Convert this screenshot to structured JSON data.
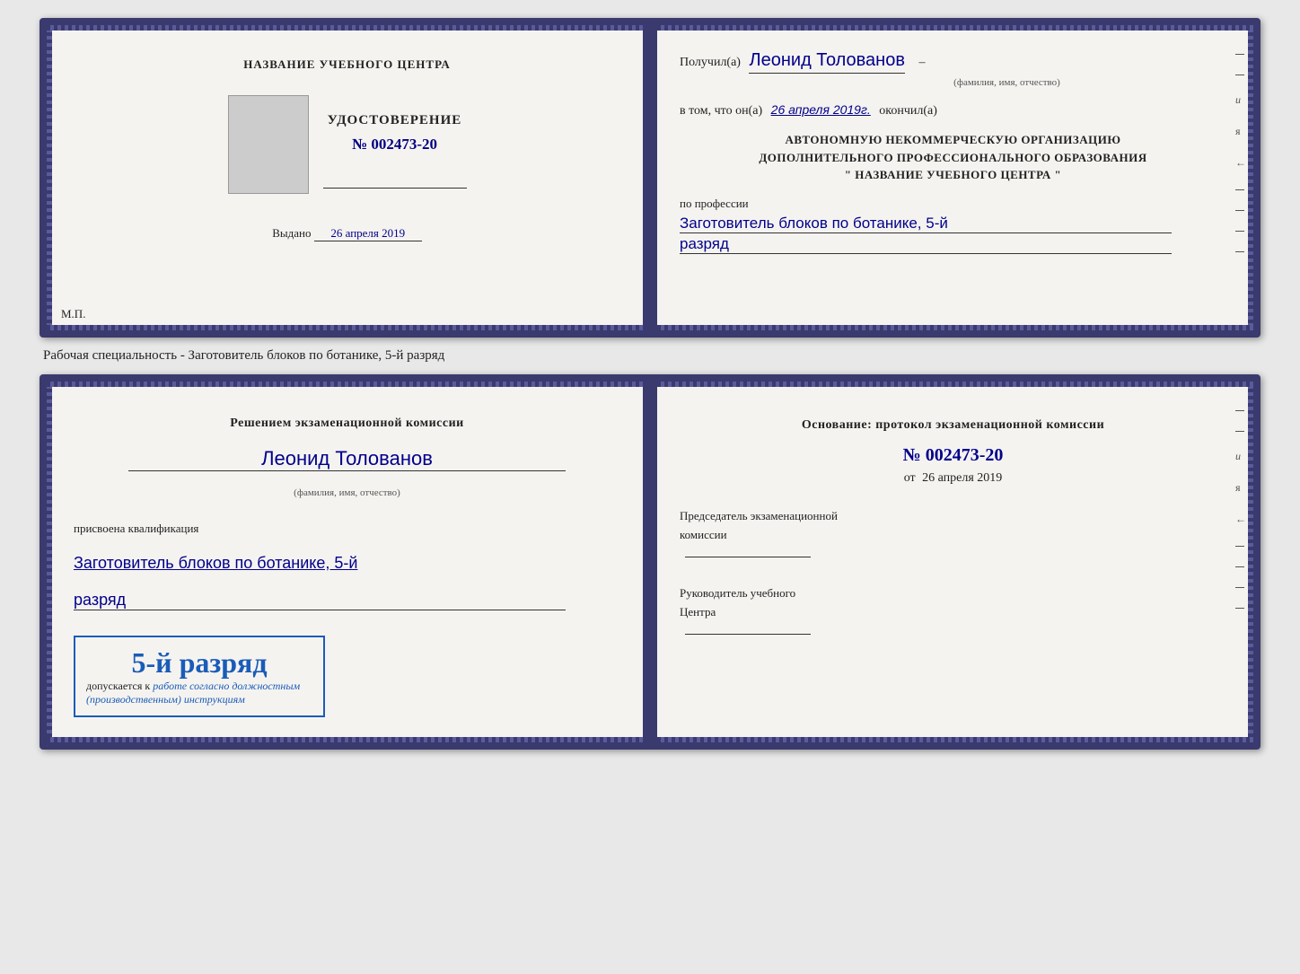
{
  "doc1": {
    "left": {
      "training_center": "НАЗВАНИЕ УЧЕБНОГО ЦЕНТРА",
      "cert_label": "УДОСТОВЕРЕНИЕ",
      "cert_number": "№ 002473-20",
      "issued_prefix": "Выдано",
      "issued_date": "26 апреля 2019",
      "mp_label": "М.П."
    },
    "right": {
      "received_prefix": "Получил(а)",
      "received_name": "Леонид Толованов",
      "fio_caption": "(фамилия, имя, отчество)",
      "vtom_prefix": "в том, что он(а)",
      "vtom_date": "26 апреля 2019г.",
      "vtom_suffix": "окончил(а)",
      "org_line1": "АВТОНОМНУЮ НЕКОММЕРЧЕСКУЮ ОРГАНИЗАЦИЮ",
      "org_line2": "ДОПОЛНИТЕЛЬНОГО ПРОФЕССИОНАЛЬНОГО ОБРАЗОВАНИЯ",
      "org_line3": "\"   НАЗВАНИЕ УЧЕБНОГО ЦЕНТРА   \"",
      "profession_label": "по профессии",
      "profession_value": "Заготовитель блоков по ботанике, 5-й",
      "razryad_value": "разряд"
    }
  },
  "specialty_label": "Рабочая специальность - Заготовитель блоков по ботанике, 5-й разряд",
  "doc2": {
    "left": {
      "commission_text1": "Решением экзаменационной комиссии",
      "person_name": "Леонид Толованов",
      "fio_caption": "(фамилия, имя, отчество)",
      "prisvoena_text": "присвоена квалификация",
      "qualification_value": "Заготовитель блоков по ботанике, 5-й",
      "razryad_value": "разряд",
      "stamp_grade": "5-й разряд",
      "stamp_allowed_prefix": "допускается к",
      "stamp_allowed_italic": " работе согласно должностным (производственным) инструкциям"
    },
    "right": {
      "osnov_text": "Основание: протокол экзаменационной комиссии",
      "protocol_number": "№  002473-20",
      "protocol_date_prefix": "от",
      "protocol_date": "26 апреля 2019",
      "chairman_label1": "Председатель экзаменационной",
      "chairman_label2": "комиссии",
      "head_label1": "Руководитель учебного",
      "head_label2": "Центра"
    }
  }
}
